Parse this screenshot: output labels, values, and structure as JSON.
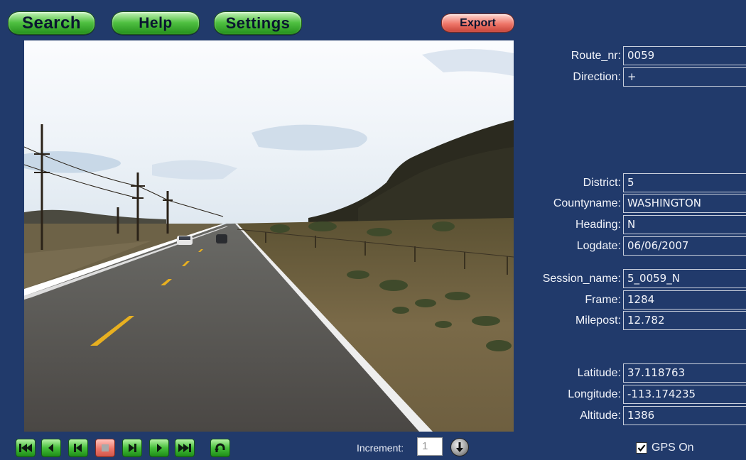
{
  "toolbar": {
    "search_label": "Search",
    "help_label": "Help",
    "settings_label": "Settings",
    "export_label": "Export"
  },
  "fields": {
    "route_nr": {
      "label": "Route_nr:",
      "value": "0059"
    },
    "direction": {
      "label": "Direction:",
      "value": "+"
    },
    "district": {
      "label": "District:",
      "value": "5"
    },
    "countyname": {
      "label": "Countyname:",
      "value": "WASHINGTON"
    },
    "heading": {
      "label": "Heading:",
      "value": "N"
    },
    "logdate": {
      "label": "Logdate:",
      "value": "06/06/2007"
    },
    "session_name": {
      "label": "Session_name:",
      "value": "5_0059_N"
    },
    "frame": {
      "label": "Frame:",
      "value": "1284"
    },
    "milepost": {
      "label": "Milepost:",
      "value": "12.782"
    },
    "latitude": {
      "label": "Latitude:",
      "value": "37.118763"
    },
    "longitude": {
      "label": "Longitude:",
      "value": "-113.174235"
    },
    "altitude": {
      "label": "Altitude:",
      "value": "1386"
    }
  },
  "playback": {
    "controls": [
      "first-frame-icon",
      "previous-icon",
      "step-back-icon",
      "stop-icon",
      "step-forward-icon",
      "play-icon",
      "last-frame-icon",
      "reset-icon"
    ],
    "increment_label": "Increment:",
    "increment_value": "1",
    "increment_button_icon": "down-arrow-icon"
  },
  "gps": {
    "checked": true,
    "label": "GPS On"
  },
  "colors": {
    "background": "#213a6b",
    "button_green": "#46c03a",
    "button_red": "#ee7568"
  }
}
